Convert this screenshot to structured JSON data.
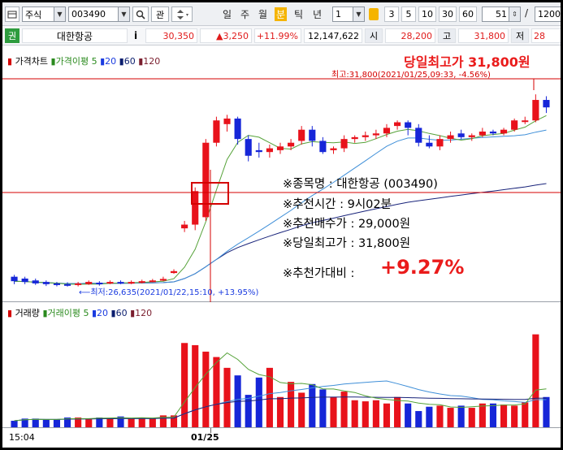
{
  "toolbar": {
    "market_select": "주식",
    "code_value": "003490",
    "kwan_label": "관",
    "periods": [
      "일",
      "주",
      "월",
      "분",
      "틱",
      "년"
    ],
    "active_period": "분",
    "interval_value": "1",
    "interval_buttons": [
      "3",
      "5",
      "10",
      "30",
      "60"
    ],
    "count_value": "51",
    "slash": "/",
    "total_value": "1200"
  },
  "quote": {
    "tag": "권",
    "stock_name": "대한항공",
    "info_label": "i",
    "price": "30,350",
    "change": "▲3,250",
    "change_rate": "+11.99%",
    "volume": "12,147,622",
    "open_label": "시",
    "open": "28,200",
    "high_label": "고",
    "high": "31,800",
    "low_label": "저",
    "low": "28"
  },
  "price_legend": {
    "title": "가격차트",
    "ma_label": "가격이평",
    "ma5": "5",
    "ma20": "20",
    "ma60": "60",
    "ma120": "120"
  },
  "volume_legend": {
    "title": "거래량",
    "ma_label": "거래이평",
    "ma5": "5",
    "ma20": "20",
    "ma60": "60",
    "ma120": "120"
  },
  "annotations": {
    "day_high_headline": "당일최고가 31,800원",
    "high_marker": "최고:31,800(2021/01/25,09:33, -4.56%)",
    "low_marker": "최저:26,635(2021/01/22,15:10, +13.95%)",
    "note_name": "※종목명 : 대한항공 (003490)",
    "note_time": "※추천시간 : 9시02분",
    "note_price": "※추천매수가 : 29,000원",
    "note_high": "※당일최고가 : 31,800원",
    "note_ratio_label": "※추천가대비 :",
    "note_ratio_value": "+9.27%"
  },
  "xaxis": {
    "left_time": "15:04",
    "date_label": "01/25"
  },
  "colors": {
    "up": "#e8121b",
    "down": "#1626d8",
    "ma5": "#55a238",
    "ma20": "#3f8fd8",
    "ma60": "#18237a",
    "ma120": "#7a1e3a",
    "highlight": "#d40000"
  },
  "chart_data": {
    "type": "candlestick",
    "price_range": [
      26500,
      32000
    ],
    "candles": [
      {
        "o": 26900,
        "c": 26780,
        "h": 26950,
        "l": 26700
      },
      {
        "o": 26850,
        "c": 26760,
        "h": 26900,
        "l": 26700
      },
      {
        "o": 26800,
        "c": 26720,
        "h": 26850,
        "l": 26680
      },
      {
        "o": 26760,
        "c": 26700,
        "h": 26800,
        "l": 26650
      },
      {
        "o": 26720,
        "c": 26680,
        "h": 26760,
        "l": 26640
      },
      {
        "o": 26700,
        "c": 26660,
        "h": 26750,
        "l": 26635
      },
      {
        "o": 26680,
        "c": 26720,
        "h": 26760,
        "l": 26640
      },
      {
        "o": 26700,
        "c": 26760,
        "h": 26800,
        "l": 26680
      },
      {
        "o": 26740,
        "c": 26700,
        "h": 26780,
        "l": 26660
      },
      {
        "o": 26720,
        "c": 26760,
        "h": 26800,
        "l": 26700
      },
      {
        "o": 26760,
        "c": 26720,
        "h": 26800,
        "l": 26700
      },
      {
        "o": 26730,
        "c": 26760,
        "h": 26800,
        "l": 26700
      },
      {
        "o": 26750,
        "c": 26780,
        "h": 26820,
        "l": 26720
      },
      {
        "o": 26780,
        "c": 26800,
        "h": 26840,
        "l": 26750
      },
      {
        "o": 26800,
        "c": 26840,
        "h": 26900,
        "l": 26780
      },
      {
        "o": 27000,
        "c": 27050,
        "h": 27100,
        "l": 26980
      },
      {
        "o": 28200,
        "c": 28300,
        "h": 28400,
        "l": 28100
      },
      {
        "o": 28300,
        "c": 29200,
        "h": 29300,
        "l": 28150
      },
      {
        "o": 28500,
        "c": 30500,
        "h": 30600,
        "l": 28400
      },
      {
        "o": 30500,
        "c": 31100,
        "h": 31200,
        "l": 30400
      },
      {
        "o": 31000,
        "c": 31150,
        "h": 31250,
        "l": 30800
      },
      {
        "o": 31150,
        "c": 30600,
        "h": 31200,
        "l": 30450
      },
      {
        "o": 30600,
        "c": 30150,
        "h": 30700,
        "l": 30000
      },
      {
        "o": 30300,
        "c": 30250,
        "h": 30500,
        "l": 30100
      },
      {
        "o": 30250,
        "c": 30350,
        "h": 30450,
        "l": 30100
      },
      {
        "o": 30300,
        "c": 30400,
        "h": 30500,
        "l": 30200
      },
      {
        "o": 30400,
        "c": 30500,
        "h": 30600,
        "l": 30300
      },
      {
        "o": 30550,
        "c": 30850,
        "h": 30950,
        "l": 30450
      },
      {
        "o": 30850,
        "c": 30550,
        "h": 30950,
        "l": 30400
      },
      {
        "o": 30550,
        "c": 30250,
        "h": 30650,
        "l": 30200
      },
      {
        "o": 30300,
        "c": 30350,
        "h": 30400,
        "l": 30200
      },
      {
        "o": 30350,
        "c": 30600,
        "h": 30700,
        "l": 30250
      },
      {
        "o": 30600,
        "c": 30650,
        "h": 30700,
        "l": 30500
      },
      {
        "o": 30650,
        "c": 30700,
        "h": 30800,
        "l": 30550
      },
      {
        "o": 30700,
        "c": 30750,
        "h": 30850,
        "l": 30600
      },
      {
        "o": 30750,
        "c": 30900,
        "h": 31000,
        "l": 30650
      },
      {
        "o": 30950,
        "c": 31050,
        "h": 31100,
        "l": 30850
      },
      {
        "o": 31050,
        "c": 30900,
        "h": 31100,
        "l": 30700
      },
      {
        "o": 30900,
        "c": 30500,
        "h": 31000,
        "l": 30400
      },
      {
        "o": 30500,
        "c": 30400,
        "h": 30700,
        "l": 30350
      },
      {
        "o": 30400,
        "c": 30600,
        "h": 30700,
        "l": 30300
      },
      {
        "o": 30600,
        "c": 30700,
        "h": 30800,
        "l": 30500
      },
      {
        "o": 30750,
        "c": 30650,
        "h": 30850,
        "l": 30600
      },
      {
        "o": 30650,
        "c": 30700,
        "h": 30750,
        "l": 30550
      },
      {
        "o": 30700,
        "c": 30800,
        "h": 30900,
        "l": 30650
      },
      {
        "o": 30800,
        "c": 30750,
        "h": 30850,
        "l": 30700
      },
      {
        "o": 30750,
        "c": 30850,
        "h": 30900,
        "l": 30700
      },
      {
        "o": 30850,
        "c": 31100,
        "h": 31150,
        "l": 30800
      },
      {
        "o": 31100,
        "c": 31100,
        "h": 31200,
        "l": 31000
      },
      {
        "o": 31100,
        "c": 31650,
        "h": 31800,
        "l": 31050
      },
      {
        "o": 31650,
        "c": 31450,
        "h": 31750,
        "l": 31300
      }
    ],
    "volume_range": [
      0,
      100
    ],
    "volumes": [
      6,
      8,
      8,
      7,
      7,
      9,
      9,
      8,
      9,
      8,
      10,
      8,
      9,
      8,
      11,
      11,
      78,
      76,
      70,
      65,
      55,
      48,
      30,
      46,
      55,
      28,
      42,
      32,
      40,
      35,
      28,
      33,
      25,
      24,
      25,
      22,
      28,
      22,
      15,
      19,
      20,
      18,
      20,
      18,
      22,
      22,
      21,
      20,
      23,
      86,
      28
    ]
  }
}
